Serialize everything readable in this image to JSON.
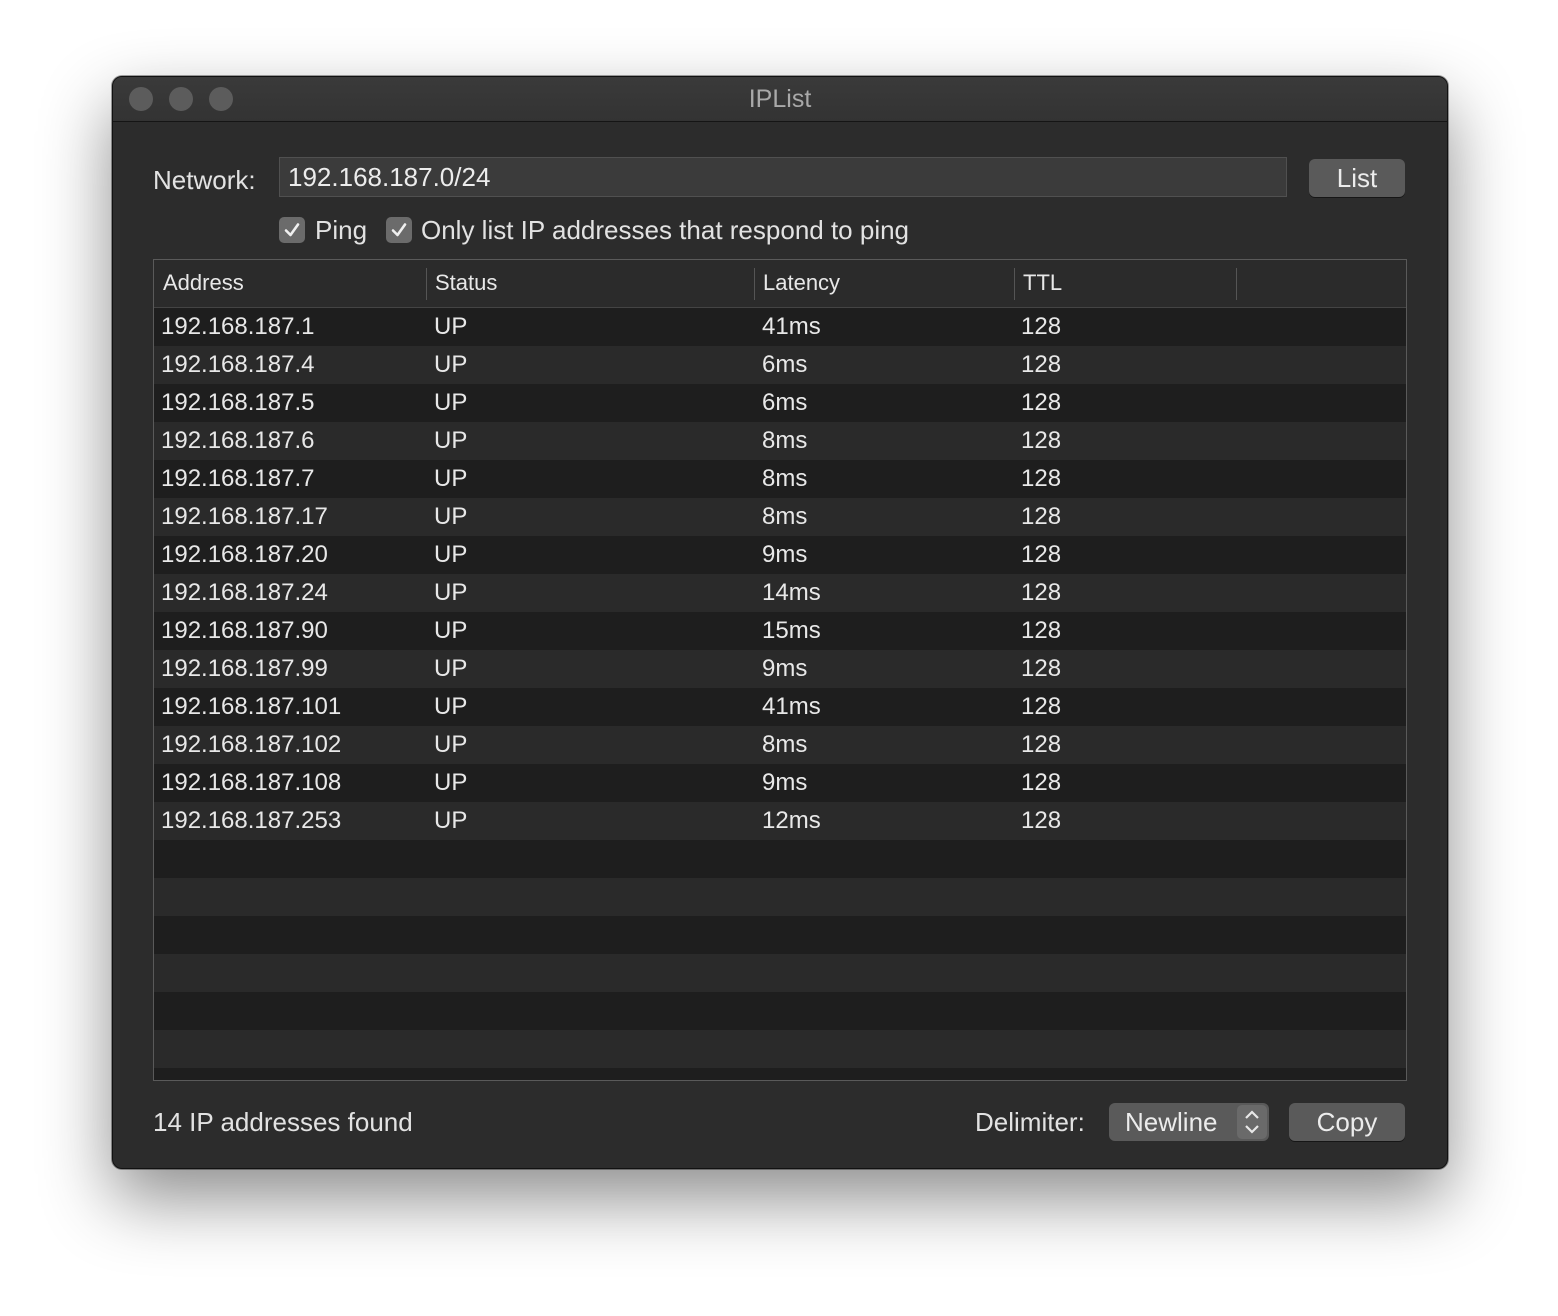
{
  "window": {
    "title": "IPList"
  },
  "network": {
    "label": "Network:",
    "value": "192.168.187.0/24",
    "list_button": "List"
  },
  "options": [
    {
      "label": "Ping",
      "checked": true
    },
    {
      "label": "Only list IP addresses that respond to ping",
      "checked": true
    }
  ],
  "table": {
    "columns": [
      "Address",
      "Status",
      "Latency",
      "TTL"
    ],
    "rows": [
      [
        "192.168.187.1",
        "UP",
        "41ms",
        "128"
      ],
      [
        "192.168.187.4",
        "UP",
        "6ms",
        "128"
      ],
      [
        "192.168.187.5",
        "UP",
        "6ms",
        "128"
      ],
      [
        "192.168.187.6",
        "UP",
        "8ms",
        "128"
      ],
      [
        "192.168.187.7",
        "UP",
        "8ms",
        "128"
      ],
      [
        "192.168.187.17",
        "UP",
        "8ms",
        "128"
      ],
      [
        "192.168.187.20",
        "UP",
        "9ms",
        "128"
      ],
      [
        "192.168.187.24",
        "UP",
        "14ms",
        "128"
      ],
      [
        "192.168.187.90",
        "UP",
        "15ms",
        "128"
      ],
      [
        "192.168.187.99",
        "UP",
        "9ms",
        "128"
      ],
      [
        "192.168.187.101",
        "UP",
        "41ms",
        "128"
      ],
      [
        "192.168.187.102",
        "UP",
        "8ms",
        "128"
      ],
      [
        "192.168.187.108",
        "UP",
        "9ms",
        "128"
      ],
      [
        "192.168.187.253",
        "UP",
        "12ms",
        "128"
      ]
    ],
    "empty_rows": 6
  },
  "footer": {
    "status": "14 IP addresses found",
    "delimiter_label": "Delimiter:",
    "delimiter_value": "Newline",
    "copy_button": "Copy"
  }
}
